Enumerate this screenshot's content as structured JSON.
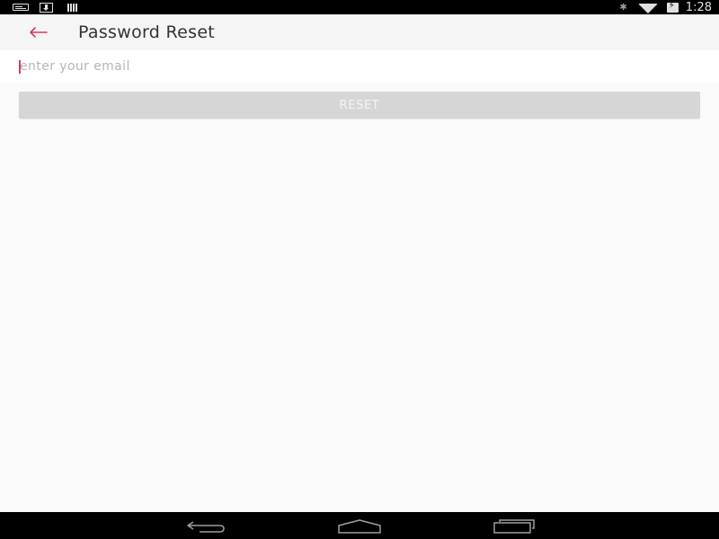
{
  "status_bar": {
    "time": "1:28",
    "icons": [
      "message-icon",
      "download-icon",
      "signal-bars-icon",
      "bluetooth-icon",
      "wifi-icon",
      "battery-charging-icon"
    ],
    "bluetooth_glyph": "✱"
  },
  "app_bar": {
    "title": "Password Reset",
    "back_icon": "arrow-back-icon",
    "accent_color": "#d63a5f"
  },
  "form": {
    "email_placeholder": "enter your email",
    "email_value": "",
    "reset_label": "RESET"
  },
  "nav_bar": {
    "icons": [
      "nav-back-icon",
      "nav-home-icon",
      "nav-recents-icon"
    ]
  }
}
